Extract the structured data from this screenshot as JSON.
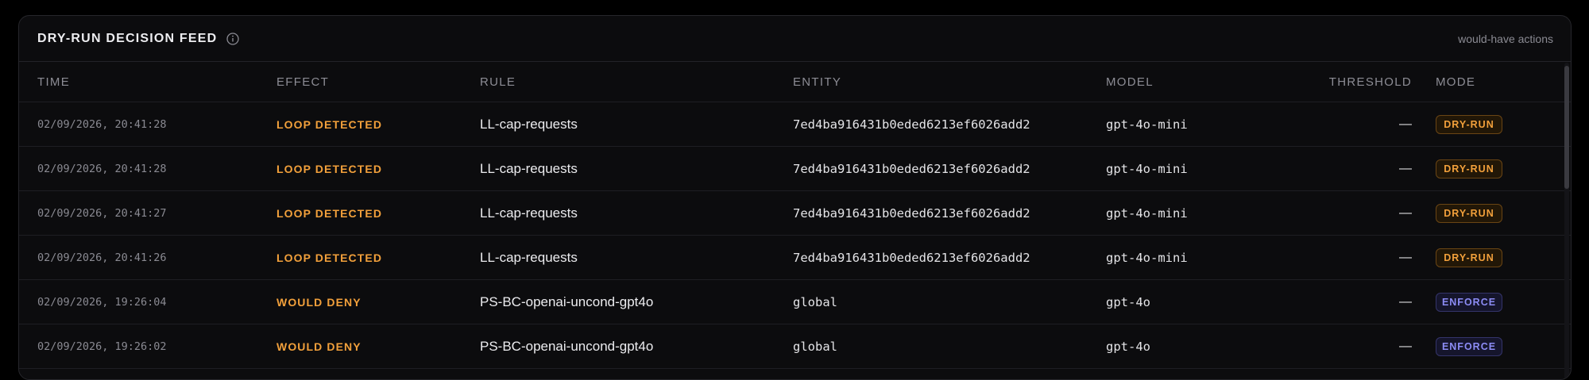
{
  "panel": {
    "title": "DRY-RUN DECISION FEED",
    "subtitle": "would-have actions",
    "info_icon": "info-icon"
  },
  "columns": {
    "time": "TIME",
    "effect": "EFFECT",
    "rule": "RULE",
    "entity": "ENTITY",
    "model": "MODEL",
    "threshold": "THRESHOLD",
    "mode": "MODE"
  },
  "rows": [
    {
      "time": "02/09/2026, 20:41:28",
      "effect": "LOOP DETECTED",
      "rule": "LL-cap-requests",
      "entity": "7ed4ba916431b0eded6213ef6026add2",
      "model": "gpt-4o-mini",
      "threshold": "—",
      "mode": "DRY-RUN"
    },
    {
      "time": "02/09/2026, 20:41:28",
      "effect": "LOOP DETECTED",
      "rule": "LL-cap-requests",
      "entity": "7ed4ba916431b0eded6213ef6026add2",
      "model": "gpt-4o-mini",
      "threshold": "—",
      "mode": "DRY-RUN"
    },
    {
      "time": "02/09/2026, 20:41:27",
      "effect": "LOOP DETECTED",
      "rule": "LL-cap-requests",
      "entity": "7ed4ba916431b0eded6213ef6026add2",
      "model": "gpt-4o-mini",
      "threshold": "—",
      "mode": "DRY-RUN"
    },
    {
      "time": "02/09/2026, 20:41:26",
      "effect": "LOOP DETECTED",
      "rule": "LL-cap-requests",
      "entity": "7ed4ba916431b0eded6213ef6026add2",
      "model": "gpt-4o-mini",
      "threshold": "—",
      "mode": "DRY-RUN"
    },
    {
      "time": "02/09/2026, 19:26:04",
      "effect": "WOULD DENY",
      "rule": "PS-BC-openai-uncond-gpt4o",
      "entity": "global",
      "model": "gpt-4o",
      "threshold": "—",
      "mode": "ENFORCE"
    },
    {
      "time": "02/09/2026, 19:26:02",
      "effect": "WOULD DENY",
      "rule": "PS-BC-openai-uncond-gpt4o",
      "entity": "global",
      "model": "gpt-4o",
      "threshold": "—",
      "mode": "ENFORCE"
    }
  ],
  "colors": {
    "effect_text": "#f2a03b",
    "dry_run_badge": "#f2a03b",
    "enforce_badge": "#8c8cf5",
    "background": "#0c0c0e"
  }
}
